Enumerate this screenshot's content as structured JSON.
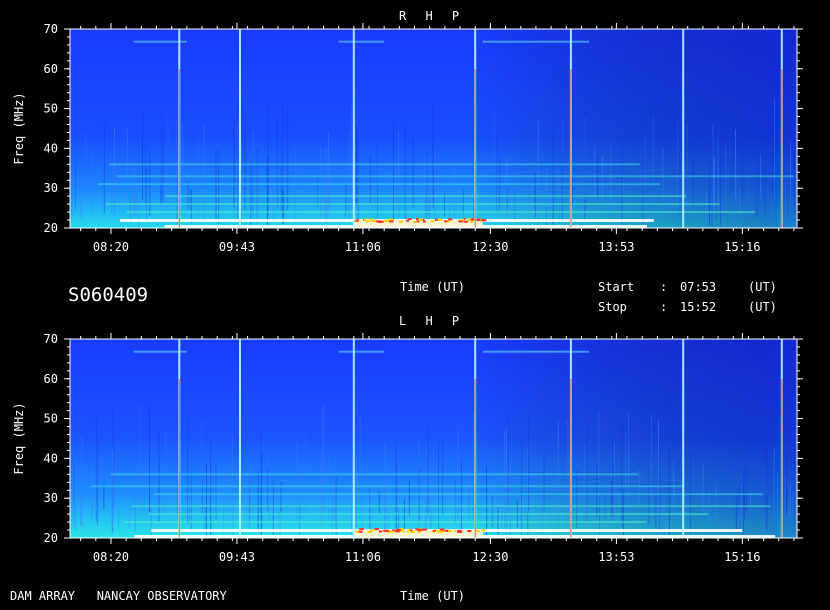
{
  "header": {
    "top_title": "R H P",
    "bottom_title": "L H P",
    "file_id": "S060409",
    "start_label": "Start",
    "stop_label": "Stop",
    "colon": ":",
    "start_time": "07:53",
    "stop_time": "15:52",
    "unit": "(UT)"
  },
  "footer": {
    "observatory": "DAM ARRAY   NANCAY OBSERVATORY"
  },
  "chart_data": [
    {
      "type": "heatmap",
      "title": "R H P",
      "xlabel": "Time (UT)",
      "ylabel": "Freq (MHz)",
      "x_tick_labels": [
        "08:20",
        "09:43",
        "11:06",
        "12:30",
        "13:53",
        "15:16"
      ],
      "y_ticks": [
        20,
        30,
        40,
        50,
        60,
        70
      ],
      "ylim": [
        20,
        70
      ],
      "xlim": [
        "07:53",
        "15:52"
      ],
      "bright_vertical_lines_ut": [
        "09:05",
        "09:45",
        "11:00",
        "12:20",
        "13:23",
        "14:37",
        "15:42"
      ],
      "emission_bands_mhz": [
        20.5,
        22,
        24,
        26,
        28,
        31,
        33,
        36
      ]
    },
    {
      "type": "heatmap",
      "title": "L H P",
      "xlabel": "Time (UT)",
      "ylabel": "Freq (MHz)",
      "x_tick_labels": [
        "08:20",
        "09:43",
        "11:06",
        "12:30",
        "13:53",
        "15:16"
      ],
      "y_ticks": [
        20,
        30,
        40,
        50,
        60,
        70
      ],
      "ylim": [
        20,
        70
      ],
      "xlim": [
        "07:53",
        "15:52"
      ],
      "bright_vertical_lines_ut": [
        "09:05",
        "09:45",
        "11:00",
        "12:20",
        "13:23",
        "14:37",
        "15:42"
      ],
      "emission_bands_mhz": [
        20.5,
        22,
        24,
        26,
        28,
        31,
        33,
        36
      ]
    }
  ]
}
